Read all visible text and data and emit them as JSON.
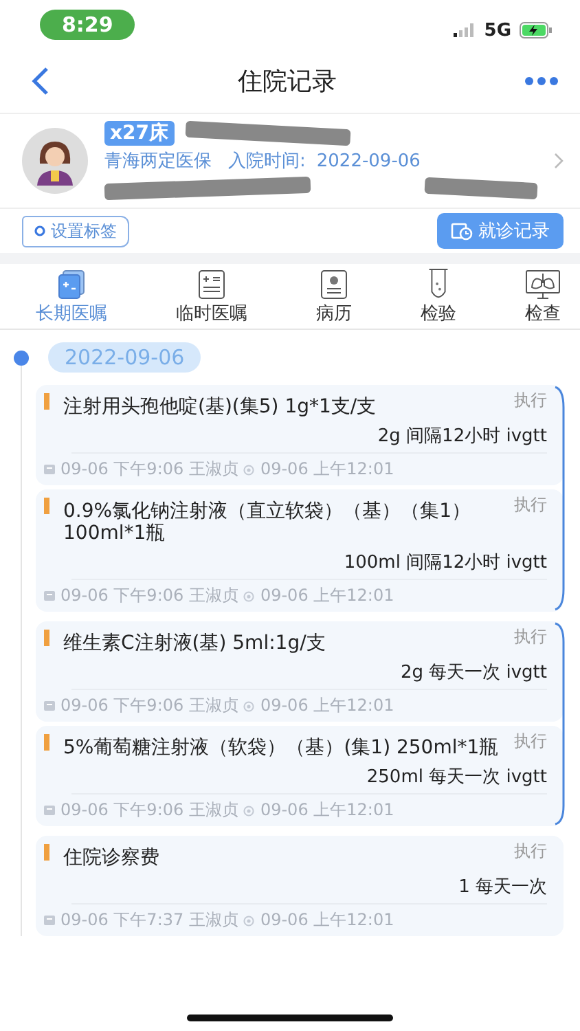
{
  "status_bar": {
    "time": "8:29",
    "network": "5G"
  },
  "nav": {
    "title": "住院记录"
  },
  "patient": {
    "bed": "x27床",
    "insurance": "青海两定医保",
    "admit_label": "入院时间:",
    "admit_date": "2022-09-06"
  },
  "tag_button": "设置标签",
  "visit_button": "就诊记录",
  "tabs": [
    {
      "label": "长期医嘱",
      "selected": true
    },
    {
      "label": "临时医嘱",
      "selected": false
    },
    {
      "label": "病历",
      "selected": false
    },
    {
      "label": "检验",
      "selected": false
    },
    {
      "label": "检查",
      "selected": false
    }
  ],
  "date": "2022-09-06",
  "groups": [
    {
      "orders": [
        {
          "name": "注射用头孢他啶(基)(集5) 1g*1支/支",
          "status": "执行",
          "dose": "2g 间隔12小时 ivgtt",
          "created": "09-06 下午9:06 王淑贞",
          "viewed": "09-06 上午12:01"
        },
        {
          "name": "0.9%氯化钠注射液（直立软袋）（基）（集1） 100ml*1瓶",
          "status": "执行",
          "dose": "100ml 间隔12小时 ivgtt",
          "created": "09-06 下午9:06 王淑贞",
          "viewed": "09-06 上午12:01"
        }
      ]
    },
    {
      "orders": [
        {
          "name": "维生素C注射液(基) 5ml:1g/支",
          "status": "执行",
          "dose": "2g 每天一次 ivgtt",
          "created": "09-06 下午9:06 王淑贞",
          "viewed": "09-06 上午12:01"
        },
        {
          "name": "5%葡萄糖注射液（软袋）（基）(集1) 250ml*1瓶",
          "status": "执行",
          "dose": "250ml 每天一次 ivgtt",
          "created": "09-06 下午9:06 王淑贞",
          "viewed": "09-06 上午12:01"
        }
      ]
    },
    {
      "orders": [
        {
          "name": "住院诊察费",
          "status": "执行",
          "dose": "1 每天一次",
          "created": "09-06 下午7:37 王淑贞",
          "viewed": "09-06 上午12:01"
        }
      ]
    }
  ]
}
